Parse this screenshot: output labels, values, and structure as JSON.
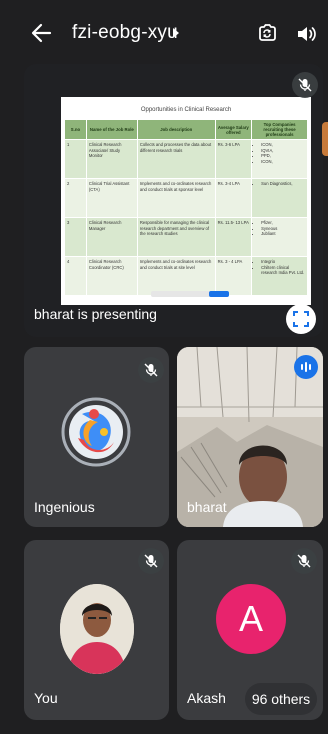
{
  "header": {
    "meeting_code": "fzi-eobg-xyu"
  },
  "presentation": {
    "presenter_label": "bharat is presenting",
    "slide": {
      "title": "Opportunities in Clinical Research",
      "columns": [
        "S.no",
        "Name of the Job Role",
        "Job description",
        "Average Salary offered",
        "Top Companies recruiting these professionals"
      ],
      "rows": [
        {
          "sno": "1",
          "role": "Clinical Research Associate/ Study Monitor",
          "desc": "Collects and processes the data about different research trials",
          "salary": "Rs. 3-6 LPA",
          "companies": [
            "ICON,",
            "IQVIA,",
            "PPD,",
            "ICON,"
          ]
        },
        {
          "sno": "2",
          "role": "Clinical Trial Assistant (CTA)",
          "desc": "Implements and co-ordinates research and conduct trials at sponsor level",
          "salary": "Rs. 3-4 LPA",
          "companies": [
            "Sun Diagnostics,"
          ]
        },
        {
          "sno": "3",
          "role": "Clinical Research Manager",
          "desc": "Responsible for managing the clinical research department and overview of the research studies",
          "salary": "Rs. 11.5- 13 LPA",
          "companies": [
            "Pfizer,",
            "Syneous",
            "Jubliant"
          ]
        },
        {
          "sno": "4",
          "role": "Clinical Research Coordinator (CRC)",
          "desc": "Implements and co-ordinates research and conduct trials at site level",
          "salary": "Rs. 3 - 4 LPA",
          "companies": [
            "Integrio",
            "Chiltern clinical research India Pvt. Ltd."
          ]
        }
      ]
    }
  },
  "participants": [
    {
      "name": "Ingenious",
      "muted": true
    },
    {
      "name": "bharat",
      "speaking": true
    },
    {
      "name": "You",
      "muted": true
    },
    {
      "name": "Akash",
      "initial": "A",
      "avatar_color": "#e8236d",
      "muted": true
    }
  ],
  "others_count_label": "96 others",
  "colors": {
    "background": "#1f1f21",
    "tile": "#3b3c3f",
    "accent": "#1a73e8"
  }
}
